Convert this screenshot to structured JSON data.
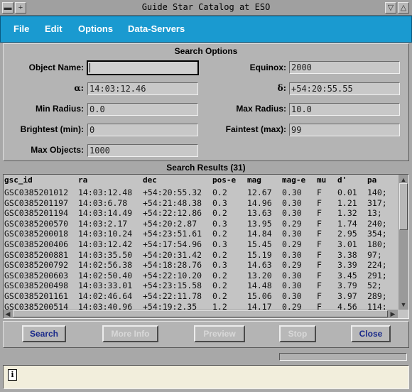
{
  "window": {
    "title": "Guide Star Catalog at ESO"
  },
  "menu": {
    "file": "File",
    "edit": "Edit",
    "options": "Options",
    "data_servers": "Data-Servers"
  },
  "search_options": {
    "heading": "Search Options",
    "object_name": {
      "label": "Object Name:",
      "value": ""
    },
    "equinox": {
      "label": "Equinox:",
      "value": "2000"
    },
    "alpha": {
      "label": "α:",
      "value": "14:03:12.46"
    },
    "delta": {
      "label": "δ:",
      "value": "+54:20:55.55"
    },
    "min_radius": {
      "label": "Min Radius:",
      "value": "0.0"
    },
    "max_radius": {
      "label": "Max Radius:",
      "value": "10.0"
    },
    "brightest": {
      "label": "Brightest (min):",
      "value": "0"
    },
    "faintest": {
      "label": "Faintest (max):",
      "value": "99"
    },
    "max_objects": {
      "label": "Max Objects:",
      "value": "1000"
    }
  },
  "results": {
    "heading": "Search Results (31)",
    "columns": [
      "gsc_id",
      "ra",
      "dec",
      "pos-e",
      "mag",
      "mag-e",
      "mu",
      "d'",
      "pa"
    ],
    "rows": [
      [
        "GSC0385201012",
        "14:03:12.48",
        "+54:20:55.32",
        "0.2",
        "12.67",
        "0.30",
        "F",
        "0.01",
        "140;"
      ],
      [
        "GSC0385201197",
        "14:03:6.78",
        "+54:21:48.38",
        "0.3",
        "14.96",
        "0.30",
        "F",
        "1.21",
        "317;"
      ],
      [
        "GSC0385201194",
        "14:03:14.49",
        "+54:22:12.86",
        "0.2",
        "13.63",
        "0.30",
        "F",
        "1.32",
        "13;"
      ],
      [
        "GSC0385200570",
        "14:03:2.17",
        "+54:20:2.87",
        "0.3",
        "13.95",
        "0.29",
        "F",
        "1.74",
        "240;"
      ],
      [
        "GSC0385200018",
        "14:03:10.24",
        "+54:23:51.61",
        "0.2",
        "14.84",
        "0.30",
        "F",
        "2.95",
        "354;"
      ],
      [
        "GSC0385200406",
        "14:03:12.42",
        "+54:17:54.96",
        "0.3",
        "15.45",
        "0.29",
        "F",
        "3.01",
        "180;"
      ],
      [
        "GSC0385200881",
        "14:03:35.50",
        "+54:20:31.42",
        "0.2",
        "15.19",
        "0.30",
        "F",
        "3.38",
        "97;"
      ],
      [
        "GSC0385200792",
        "14:02:56.38",
        "+54:18:28.76",
        "0.3",
        "14.63",
        "0.29",
        "F",
        "3.39",
        "224;"
      ],
      [
        "GSC0385200603",
        "14:02:50.40",
        "+54:22:10.20",
        "0.2",
        "13.20",
        "0.30",
        "F",
        "3.45",
        "291;"
      ],
      [
        "GSC0385200498",
        "14:03:33.01",
        "+54:23:15.58",
        "0.2",
        "14.48",
        "0.30",
        "F",
        "3.79",
        "52;"
      ],
      [
        "GSC0385201161",
        "14:02:46.64",
        "+54:22:11.78",
        "0.2",
        "15.06",
        "0.30",
        "F",
        "3.97",
        "289;"
      ],
      [
        "GSC0385200514",
        "14:03:40.96",
        "+54:19:2.35",
        "1.2",
        "14.17",
        "0.29",
        "F",
        "4.56",
        "114;"
      ]
    ]
  },
  "buttons": {
    "search": "Search",
    "more_info": "More Info",
    "preview": "Preview",
    "stop": "Stop",
    "close": "Close"
  },
  "message": {
    "icon": "info-icon",
    "text": ""
  },
  "colors": {
    "menubar": "#1a9ad0",
    "active_button_text": "#1a2a8a",
    "message_bg": "#f2eedc"
  }
}
